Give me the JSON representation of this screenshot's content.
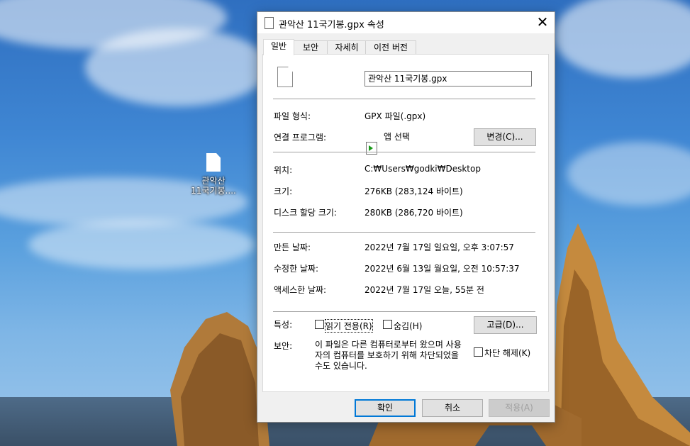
{
  "desktop": {
    "icon_label_line1": "관악산",
    "icon_label_line2": "11국기봉...."
  },
  "dialog": {
    "title": "관악산 11국기봉.gpx 속성",
    "tabs": [
      "일반",
      "보안",
      "자세히",
      "이전 버전"
    ],
    "filename": "관악산 11국기봉.gpx",
    "file_type": {
      "label": "파일 형식:",
      "value": "GPX 파일(.gpx)"
    },
    "opens_with": {
      "label": "연결 프로그램:",
      "value": "앱 선택",
      "button": "변경(C)..."
    },
    "location": {
      "label": "위치:",
      "value": "C:₩Users₩godki₩Desktop"
    },
    "size": {
      "label": "크기:",
      "value": "276KB (283,124 바이트)"
    },
    "size_on_disk": {
      "label": "디스크 할당 크기:",
      "value": "280KB (286,720 바이트)"
    },
    "created": {
      "label": "만든 날짜:",
      "value": "2022년 7월 17일 일요일, 오후 3:07:57"
    },
    "modified": {
      "label": "수정한 날짜:",
      "value": "2022년 6월 13일 월요일, 오전 10:57:37"
    },
    "accessed": {
      "label": "액세스한 날짜:",
      "value": "2022년 7월 17일 오늘, 55분 전"
    },
    "attributes": {
      "label": "특성:",
      "readonly": "읽기 전용(R)",
      "hidden": "숨김(H)",
      "advanced_button": "고급(D)..."
    },
    "security": {
      "label": "보안:",
      "text": "이 파일은 다른 컴퓨터로부터 왔으며 사용자의 컴퓨터를 보호하기 위해 차단되었을 수도 있습니다.",
      "unblock": "차단 해제(K)"
    },
    "buttons": {
      "ok": "확인",
      "cancel": "취소",
      "apply": "적용(A)"
    }
  }
}
